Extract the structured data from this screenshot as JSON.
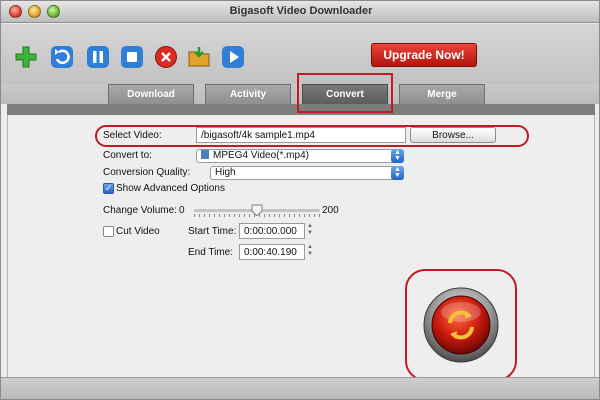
{
  "window": {
    "title": "Bigasoft Video Downloader"
  },
  "toolbar": {
    "icons": [
      "add-icon",
      "refresh-icon",
      "pause-icon",
      "stop-icon",
      "delete-icon",
      "open-folder-icon",
      "play-icon"
    ],
    "upgrade_label": "Upgrade Now!"
  },
  "tabs": [
    {
      "label": "Download",
      "active": false
    },
    {
      "label": "Activity",
      "active": false
    },
    {
      "label": "Convert",
      "active": true
    },
    {
      "label": "Merge",
      "active": false
    }
  ],
  "convert": {
    "select_video_label": "Select Video:",
    "select_video_value": "/bigasoft/4k sample1.mp4",
    "browse_label": "Browse...",
    "convert_to_label": "Convert to:",
    "convert_to_value": "MPEG4 Video(*.mp4)",
    "quality_label": "Conversion Quality:",
    "quality_value": "High",
    "advanced_label": "Show Advanced Options",
    "advanced_checked": true,
    "volume_label": "Change Volume:",
    "volume_min": "0",
    "volume_max": "200",
    "volume_value": 100,
    "cut_video_label": "Cut Video",
    "cut_video_checked": false,
    "start_time_label": "Start Time:",
    "start_time_value": "0:00:00.000",
    "end_time_label": "End Time:",
    "end_time_value": "0:00:40.190"
  },
  "colors": {
    "highlight": "#c21b24",
    "upgrade": "#c21b10",
    "accent_blue": "#2464c8"
  }
}
